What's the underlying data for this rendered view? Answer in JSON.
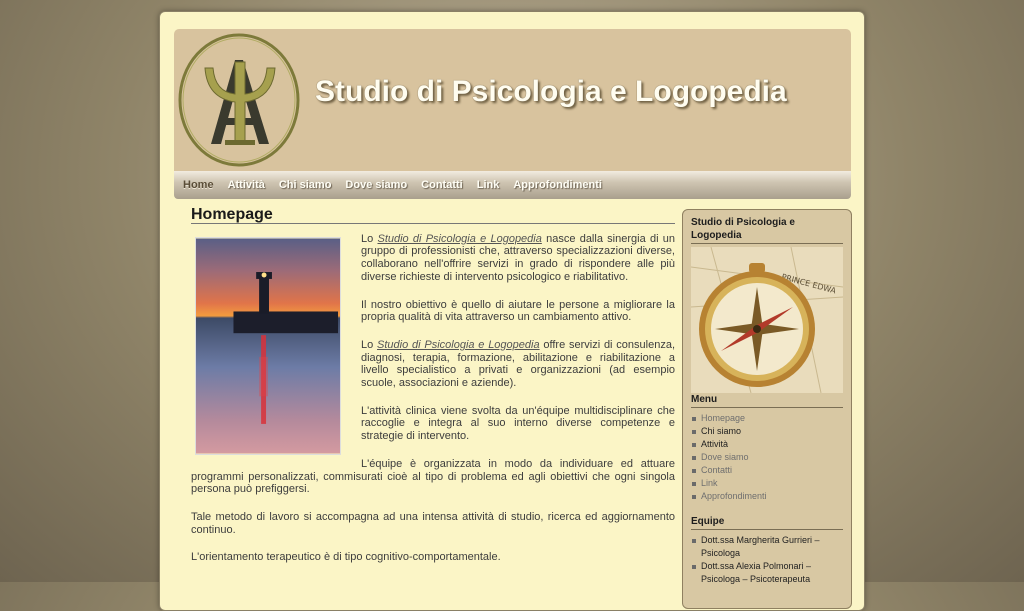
{
  "header": {
    "title": "Studio di Psicologia e Logopedia"
  },
  "nav": [
    "Home",
    "Attività",
    "Chi siamo",
    "Dove siamo",
    "Contatti",
    "Link",
    "Approfondimenti"
  ],
  "content": {
    "heading": "Homepage",
    "p1": {
      "pre": "Lo ",
      "link": "Studio di Psicologia e Logopedia",
      "post": " nasce dalla sinergia di un gruppo di professionisti che, attraverso specializzazioni diverse, collaborano nell'offrire servizi in grado di rispondere alle più diverse richieste di intervento psicologico e riabilitativo."
    },
    "p2": "Il nostro obiettivo è quello di aiutare le persone a migliorare la propria qualità di vita attraverso un cambiamento attivo.",
    "p3": {
      "pre": "Lo ",
      "link": "Studio di Psicologia e Logopedia",
      "post": " offre servizi di consulenza, diagnosi, terapia, formazione, abilitazione e riabilitazione a livello specialistico a privati e organizzazioni (ad esempio scuole, associazioni e aziende)."
    },
    "p4": "L'attività clinica viene svolta da un'équipe multidisciplinare che raccoglie e integra al suo interno diverse competenze e strategie di intervento.",
    "p5": "L'équipe è organizzata in modo da individuare ed attuare programmi personalizzati, commisurati cioè al tipo di problema ed agli obiettivi che ogni singola persona può prefiggersi.",
    "p6": "Tale metodo di lavoro si accompagna ad una intensa attività di studio, ricerca ed aggiornamento continuo.",
    "p7": "L'orientamento terapeutico è di tipo cognitivo-comportamentale."
  },
  "sidebar": {
    "title": "Studio di Psicologia e Logopedia",
    "compass_text": "PRINCE EDWA",
    "menu_title": "Menu",
    "menu": [
      "Homepage",
      "Chi siamo",
      "Attività",
      "Dove siamo",
      "Contatti",
      "Link",
      "Approfondimenti"
    ],
    "equipe_title": "Equipe",
    "equipe": [
      "Dott.ssa Margherita Gurrieri – Psicologa",
      "Dott.ssa Alexia Polmonari – Psicologa – Psicoterapeuta"
    ]
  },
  "colors": {
    "page_bg": "#fbf5c6",
    "header_bg": "#d8c39e",
    "sidebar_bg": "#d8c8a3"
  }
}
